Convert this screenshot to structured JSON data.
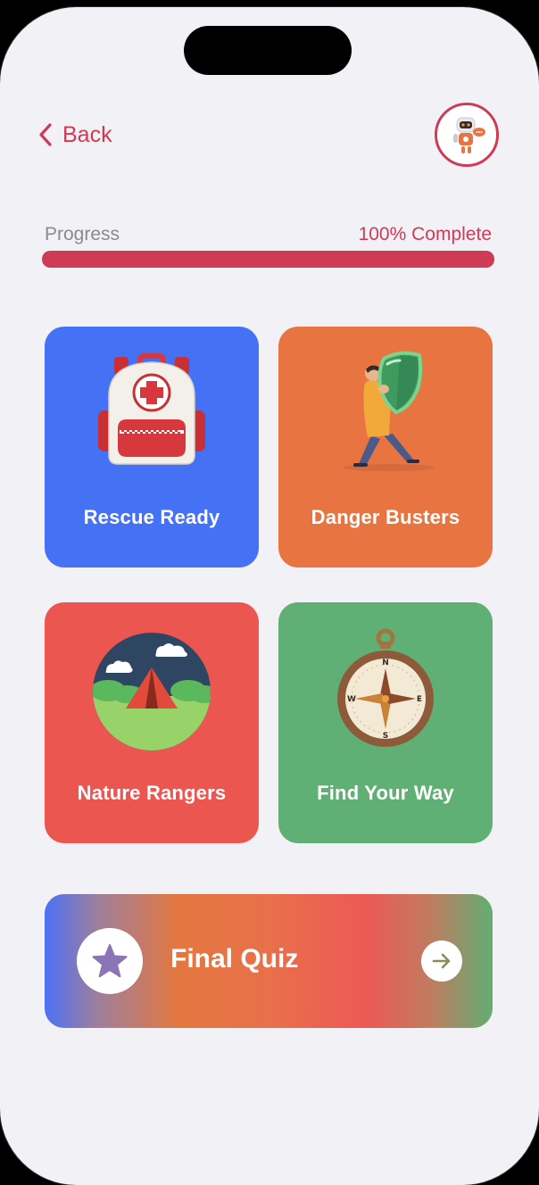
{
  "header": {
    "back_label": "Back",
    "avatar_icon": "robot-avatar-icon"
  },
  "progress": {
    "label": "Progress",
    "percent_text": "100% Complete",
    "value": 1.0,
    "color": "#cf3a55"
  },
  "modules": [
    {
      "title": "Rescue Ready",
      "color": "#4571f5",
      "icon": "first-aid-backpack-icon"
    },
    {
      "title": "Danger Busters",
      "color": "#e87541",
      "icon": "shield-person-icon"
    },
    {
      "title": "Nature Rangers",
      "color": "#ec5651",
      "icon": "camping-tent-icon"
    },
    {
      "title": "Find Your Way",
      "color": "#60b075",
      "icon": "compass-icon"
    }
  ],
  "final_quiz": {
    "title": "Final Quiz",
    "icon": "star-icon",
    "arrow_icon": "arrow-right-icon"
  }
}
